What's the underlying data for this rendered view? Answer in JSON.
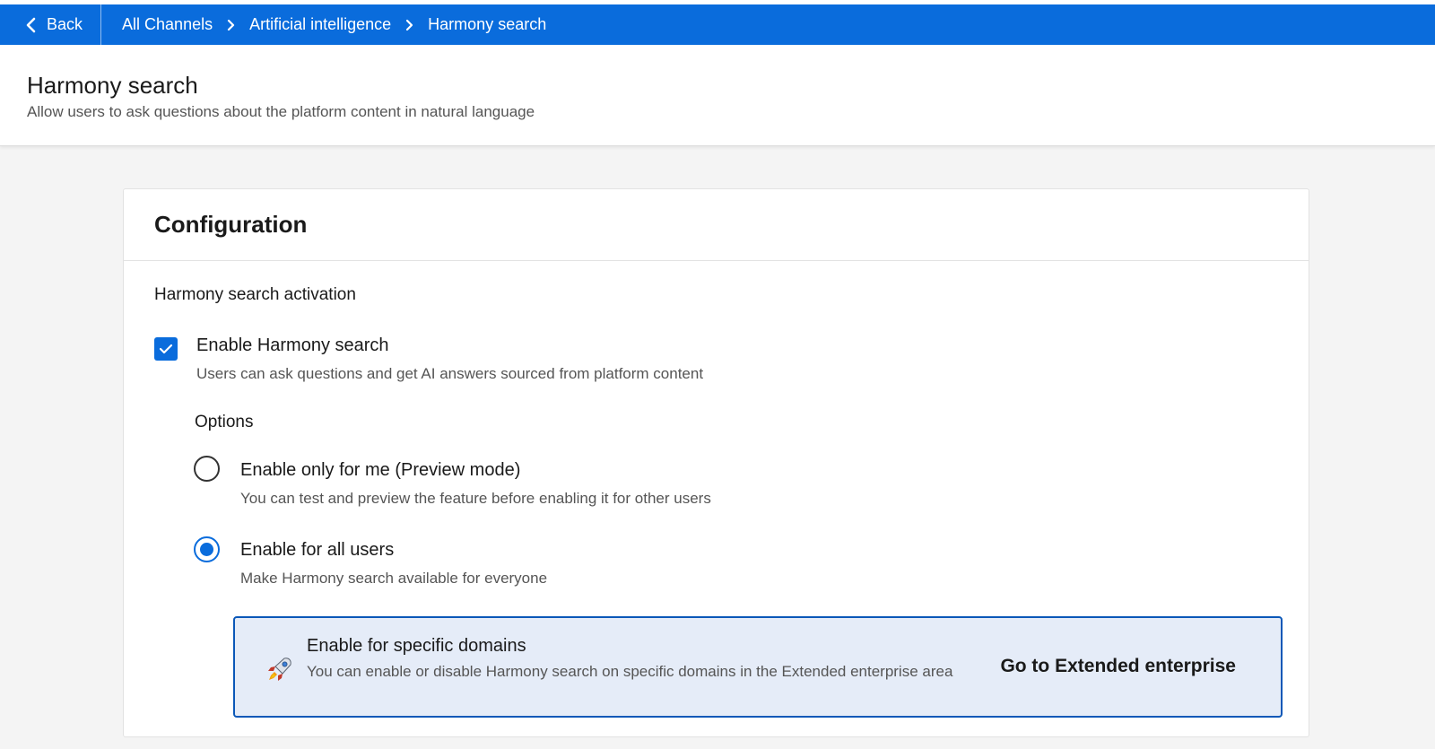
{
  "topbar": {
    "back_label": "Back",
    "breadcrumbs": [
      "All Channels",
      "Artificial intelligence",
      "Harmony search"
    ],
    "color": "#0a6cdc"
  },
  "header": {
    "title": "Harmony search",
    "subtitle": "Allow users to ask questions about the platform content in natural language"
  },
  "card": {
    "title": "Configuration",
    "section_title": "Harmony search activation",
    "enable": {
      "label": "Enable Harmony search",
      "description": "Users can ask questions and get AI answers sourced from platform content",
      "checked": true
    },
    "options_title": "Options",
    "options": [
      {
        "label": "Enable only for me (Preview mode)",
        "description": "You can test and preview the feature before enabling it for other users",
        "selected": false
      },
      {
        "label": "Enable for all users",
        "description": "Make Harmony search available for everyone",
        "selected": true
      }
    ],
    "promo": {
      "icon": "rocket-icon",
      "title": "Enable for specific domains",
      "description": "You can enable or disable Harmony search on specific domains in the Extended enterprise area",
      "link": "Go to Extended enterprise"
    }
  }
}
